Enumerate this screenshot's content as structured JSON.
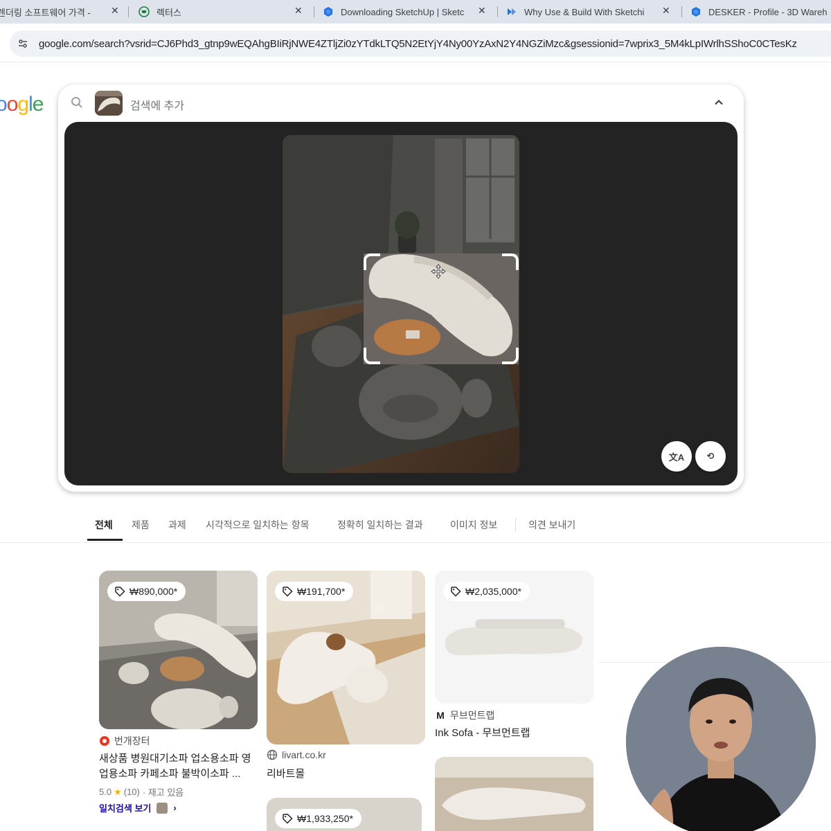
{
  "browser": {
    "tabs": [
      {
        "label": "렌더링 소프트웨어 가격 - ",
        "icon": "google-icon",
        "closable": true
      },
      {
        "label": "렉터스",
        "icon": "shop-icon",
        "closable": false
      },
      {
        "label": "Downloading SketchUp | Sketc",
        "icon": "sketchup-icon",
        "closable": true
      },
      {
        "label": "Why Use & Build With Sketchi",
        "icon": "extension-icon",
        "closable": true
      },
      {
        "label": "DESKER - Profile - 3D Wareh",
        "icon": "sketchup-icon",
        "closable": false
      }
    ],
    "url": "google.com/search?vsrid=CJ6Phd3_gtnp9wEQAhgBIiRjNWE4ZTljZi0zYTdkLTQ5N2EtYjY4Ny00YzAxN2Y4NGZiMzc&gsessionid=7wprix3_5M4kLpIWrlhSShoC0CTesKz"
  },
  "logo": {
    "text": "oogle",
    "colors": [
      "#4285f4",
      "#ea4335",
      "#fbbc05",
      "#4285f4",
      "#34a853",
      "#ea4335"
    ]
  },
  "lens": {
    "placeholder": "검색에 추가",
    "translate_label": "文A",
    "reset_label": "⟲"
  },
  "result_tabs": [
    {
      "label": "전체",
      "active": true
    },
    {
      "label": "제품",
      "active": false
    },
    {
      "label": "과제",
      "active": false
    },
    {
      "label": "시각적으로 일치하는 항목",
      "active": false
    },
    {
      "label": "정확히 일치하는 결과",
      "active": false
    },
    {
      "label": "이미지 정보",
      "active": false
    },
    {
      "label": "의견 보내기",
      "active": false
    }
  ],
  "results": [
    {
      "price": "₩890,000*",
      "source": "번개장터",
      "title_line1": "새상품 병원대기소파 업소용소파 영",
      "title_line2": "업용소파 카페소파 불박이소파 ...",
      "rating": "5.0",
      "reviews": "(10)",
      "stock": "· 재고 있음",
      "link": "일치검색 보기"
    },
    {
      "price": "₩191,700*",
      "source": "livart.co.kr",
      "title": "리바트몰"
    },
    {
      "price": "₩2,035,000*",
      "source": "무브먼트랩",
      "title": "Ink Sofa - 무브먼트랩"
    },
    {
      "price": "₩1,933,250*"
    }
  ],
  "colors": {
    "accent_link": "#1a0dab",
    "tab_strip": "#dfe3eb",
    "stage_bg": "#232323",
    "star": "#f5b400"
  }
}
